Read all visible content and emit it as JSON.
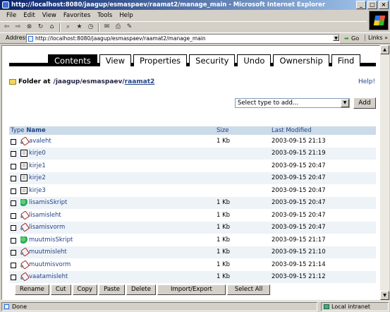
{
  "window": {
    "title": "http://localhost:8080/jaagup/esmaspaev/raamat2/manage_main - Microsoft Internet Explorer",
    "minimize": "_",
    "maximize": "□",
    "close": "×"
  },
  "menu": [
    {
      "label": "File"
    },
    {
      "label": "Edit"
    },
    {
      "label": "View"
    },
    {
      "label": "Favorites"
    },
    {
      "label": "Tools"
    },
    {
      "label": "Help"
    }
  ],
  "address": {
    "label": "Address",
    "url": "http://localhost:8080/jaagup/esmaspaev/raamat2/manage_main",
    "go": "Go",
    "links": "Links »"
  },
  "tabs": [
    {
      "label": "Contents",
      "active": true
    },
    {
      "label": "View"
    },
    {
      "label": "Properties"
    },
    {
      "label": "Security"
    },
    {
      "label": "Undo"
    },
    {
      "label": "Ownership"
    },
    {
      "label": "Find"
    }
  ],
  "folder": {
    "label": "Folder at",
    "path1": "/jaagup/esmaspaev/",
    "path2": "raamat2",
    "help": "Help!"
  },
  "add": {
    "select_value": "Select type to add...",
    "button": "Add"
  },
  "table": {
    "type_header": "Type",
    "name_header": "Name",
    "size_header": "Size",
    "modified_header": "Last Modified",
    "rows": [
      {
        "icon": "link",
        "name": "avaleht",
        "size": "1 Kb",
        "date": "2003-09-15 21:13"
      },
      {
        "icon": "doc",
        "name": "kirje0",
        "size": "",
        "date": "2003-09-15 21:19"
      },
      {
        "icon": "doc",
        "name": "kirje1",
        "size": "",
        "date": "2003-09-15 20:47"
      },
      {
        "icon": "doc",
        "name": "kirje2",
        "size": "",
        "date": "2003-09-15 20:47"
      },
      {
        "icon": "doc",
        "name": "kirje3",
        "size": "",
        "date": "2003-09-15 20:47"
      },
      {
        "icon": "snake",
        "name": "lisamisSkript",
        "size": "1 Kb",
        "date": "2003-09-15 20:47"
      },
      {
        "icon": "link",
        "name": "lisamisleht",
        "size": "1 Kb",
        "date": "2003-09-15 20:47"
      },
      {
        "icon": "link",
        "name": "lisamisvorm",
        "size": "1 Kb",
        "date": "2003-09-15 20:47"
      },
      {
        "icon": "snake",
        "name": "muutmisSkript",
        "size": "1 Kb",
        "date": "2003-09-15 21:17"
      },
      {
        "icon": "link",
        "name": "muutmisleht",
        "size": "1 Kb",
        "date": "2003-09-15 21:10"
      },
      {
        "icon": "link",
        "name": "muutmisvorm",
        "size": "1 Kb",
        "date": "2003-09-15 21:14"
      },
      {
        "icon": "link",
        "name": "vaatamisleht",
        "size": "1 Kb",
        "date": "2003-09-15 21:12"
      }
    ]
  },
  "buttons": {
    "rename": "Rename",
    "cut": "Cut",
    "copy": "Copy",
    "paste": "Paste",
    "delete": "Delete",
    "import_export": "Import/Export",
    "select_all": "Select All"
  },
  "status": {
    "left": "Done",
    "right": "Local intranet"
  }
}
